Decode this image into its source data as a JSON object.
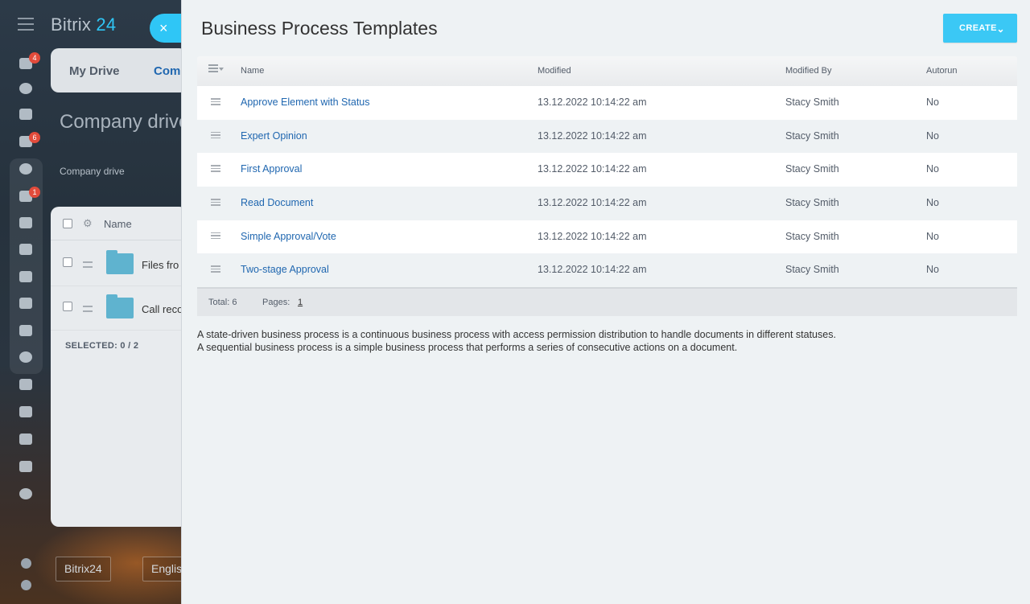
{
  "background": {
    "logo_text": "Bitrix",
    "logo_number": "24",
    "close_symbol": "×",
    "drive_tabs": {
      "my_drive": "My Drive",
      "company": "Comp"
    },
    "drive_title": "Company drive",
    "breadcrumb": "Company drive",
    "list": {
      "name_header": "Name",
      "rows": [
        {
          "name": "Files fro"
        },
        {
          "name": "Call reco"
        }
      ],
      "selected_label": "SELECTED: 0 / 2"
    },
    "footer_buttons": {
      "bitrix": "Bitrix24",
      "language": "Englis"
    },
    "nav_badges": {
      "feed": "4",
      "tasks": "6",
      "chat": "1"
    },
    "nav_icons": [
      "feed-icon",
      "target-icon",
      "cart-icon",
      "tasks-icon",
      "crm-icon",
      "chat-icon",
      "messages-icon",
      "calendar-icon",
      "documents-icon",
      "drive-icon",
      "mail-icon",
      "contacts-icon",
      "contact-card-icon",
      "robot-icon",
      "box-icon",
      "building-icon",
      "more-icon",
      "help-icon",
      "network-icon"
    ]
  },
  "slider": {
    "title": "Business Process Templates",
    "create_label": "CREATE",
    "columns": {
      "name": "Name",
      "modified": "Modified",
      "modified_by": "Modified By",
      "autorun": "Autorun"
    },
    "rows": [
      {
        "name": "Approve Element with Status",
        "modified": "13.12.2022 10:14:22 am",
        "modified_by": "Stacy Smith",
        "autorun": "No"
      },
      {
        "name": "Expert Opinion",
        "modified": "13.12.2022 10:14:22 am",
        "modified_by": "Stacy Smith",
        "autorun": "No"
      },
      {
        "name": "First Approval",
        "modified": "13.12.2022 10:14:22 am",
        "modified_by": "Stacy Smith",
        "autorun": "No"
      },
      {
        "name": "Read Document",
        "modified": "13.12.2022 10:14:22 am",
        "modified_by": "Stacy Smith",
        "autorun": "No"
      },
      {
        "name": "Simple Approval/Vote",
        "modified": "13.12.2022 10:14:22 am",
        "modified_by": "Stacy Smith",
        "autorun": "No"
      },
      {
        "name": "Two-stage Approval",
        "modified": "13.12.2022 10:14:22 am",
        "modified_by": "Stacy Smith",
        "autorun": "No"
      }
    ],
    "footer": {
      "total": "Total: 6",
      "pages_label": "Pages:",
      "page": "1"
    },
    "description": [
      "A state-driven business process is a continuous business process with access permission distribution to handle documents in different statuses.",
      "A sequential business process is a simple business process that performs a series of consecutive actions on a document."
    ]
  },
  "colors": {
    "accent": "#3bc8f5",
    "link": "#2067b0",
    "badge": "#e24b3b"
  }
}
